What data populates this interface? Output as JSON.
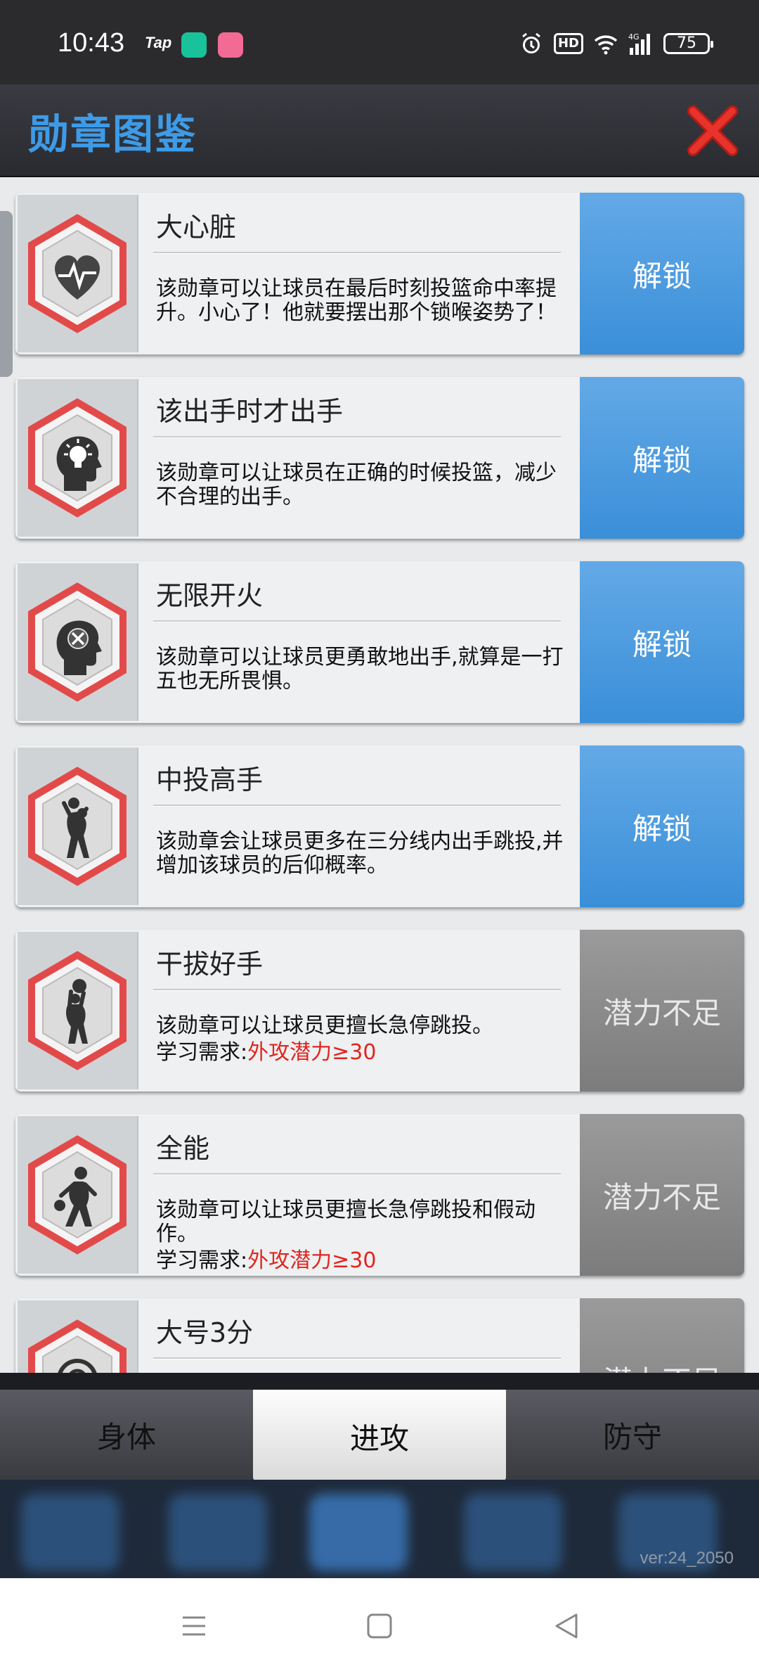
{
  "status_bar": {
    "time": "10:43",
    "tap_label": "Tap",
    "network": "4G",
    "hd": "HD",
    "battery": "75"
  },
  "header": {
    "title": "勋章图鉴",
    "close_icon": "close-x-icon",
    "title_color": "#3d9be8",
    "close_color": "#e0261f"
  },
  "badges": [
    {
      "title": "大心脏",
      "icon": "heart-pulse-icon",
      "desc": "该勋章可以让球员在最后时刻投篮命中率提升。小心了！他就要摆出那个锁喉姿势了！",
      "req_label": "",
      "req_value": "",
      "action": "解锁",
      "state": "unlock"
    },
    {
      "title": "该出手时才出手",
      "icon": "head-lightbulb-icon",
      "desc": "该勋章可以让球员在正确的时候投篮，减少不合理的出手。",
      "req_label": "",
      "req_value": "",
      "action": "解锁",
      "state": "unlock"
    },
    {
      "title": "无限开火",
      "icon": "head-x-icon",
      "desc": "该勋章可以让球员更勇敢地出手,就算是一打五也无所畏惧。",
      "req_label": "",
      "req_value": "",
      "action": "解锁",
      "state": "unlock"
    },
    {
      "title": "中投高手",
      "icon": "player-shooting-icon",
      "desc": "该勋章会让球员更多在三分线内出手跳投,并增加该球员的后仰概率。",
      "req_label": "",
      "req_value": "",
      "action": "解锁",
      "state": "unlock"
    },
    {
      "title": "干拔好手",
      "icon": "player-jumpshot-icon",
      "desc": "该勋章可以让球员更擅长急停跳投。",
      "req_label": "学习需求:",
      "req_value": "外攻潜力≥30",
      "action": "潜力不足",
      "state": "locked"
    },
    {
      "title": "全能",
      "icon": "player-dribble-icon",
      "desc": "该勋章可以让球员更擅长急停跳投和假动作。",
      "req_label": "学习需求:",
      "req_value": "外攻潜力≥30",
      "action": "潜力不足",
      "state": "locked"
    },
    {
      "title": "大号3分",
      "icon": "target-icon",
      "desc": "",
      "req_label": "",
      "req_value": "",
      "action": "潜力不足",
      "state": "locked"
    }
  ],
  "tabs": [
    {
      "label": "身体",
      "active": false
    },
    {
      "label": "进攻",
      "active": true
    },
    {
      "label": "防守",
      "active": false
    }
  ],
  "version": "ver:24_2050",
  "colors": {
    "unlock_button": "#3a8fd9",
    "locked_button": "#8a8a8a",
    "requirement_value": "#e0261f",
    "badge_hex_border": "#e24a4a"
  }
}
